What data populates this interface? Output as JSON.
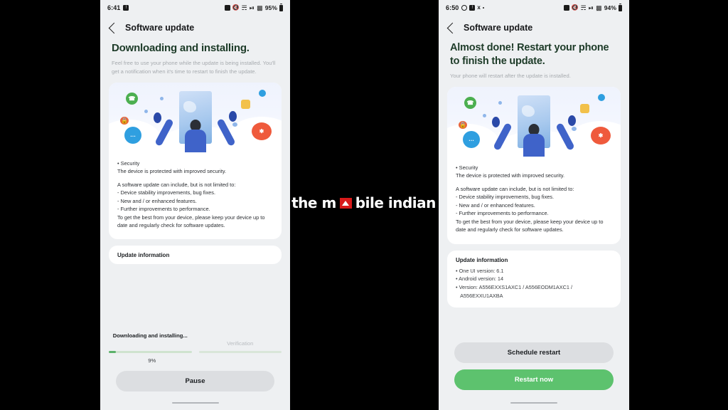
{
  "watermark": {
    "part1": "the m",
    "part2": "bile indian"
  },
  "phones": [
    {
      "id": "left",
      "statusbar": {
        "time": "6:41",
        "left_icons": [
          "notification-square-icon"
        ],
        "right_icons": [
          "alarm-icon",
          "mute-icon",
          "wifi-icon",
          "nfc-icon",
          "signal-icon"
        ],
        "battery": "95%"
      },
      "appbar": {
        "back": "back-icon",
        "title": "Software update"
      },
      "hero": {
        "title": "Downloading and installing.",
        "subtitle": "Feel free to use your phone while the update is being installed. You'll get a notification when it's time to restart to finish the update."
      },
      "notes": {
        "security_bullet": "• Security",
        "security_text": "The device is protected with improved security.",
        "intro": "A software update can include, but is not limited to:",
        "items": [
          " - Device stability improvements, bug fixes.",
          " - New and / or enhanced features.",
          " - Further improvements to performance."
        ],
        "outro": "To get the best from your device, please keep your device up to date and regularly check for software updates."
      },
      "info": {
        "title": "Update information",
        "lines": []
      },
      "progress": {
        "step1_label": "Downloading and installing...",
        "step2_label": "Verification",
        "percent_text": "9%",
        "percent_value": 9
      },
      "buttons": [
        {
          "label": "Pause",
          "style": "grey"
        }
      ]
    },
    {
      "id": "right",
      "statusbar": {
        "time": "6:50",
        "left_icons": [
          "whatsapp-icon",
          "notification-square-icon",
          "x-twitter-icon",
          "more-dot-icon"
        ],
        "right_icons": [
          "alarm-icon",
          "mute-icon",
          "wifi-icon",
          "nfc-icon",
          "signal-icon"
        ],
        "battery": "94%"
      },
      "appbar": {
        "back": "back-icon",
        "title": "Software update"
      },
      "hero": {
        "title": "Almost done! Restart your phone to finish the update.",
        "subtitle": "Your phone will restart after the update is installed."
      },
      "notes": {
        "security_bullet": "• Security",
        "security_text": "The device is protected with improved security.",
        "intro": "A software update can include, but is not limited to:",
        "items": [
          " - Device stability improvements, bug fixes.",
          " - New and / or enhanced features.",
          " - Further improvements to performance."
        ],
        "outro": "To get the best from your device, please keep your device up to date and regularly check for software updates."
      },
      "info": {
        "title": "Update information",
        "lines": [
          "• One UI version: 6.1",
          "• Android version: 14",
          "• Version: A556EXXS1AXC1 / A556EODM1AXC1 /\n   A556EXXU1AXBA"
        ]
      },
      "progress": null,
      "buttons": [
        {
          "label": "Schedule restart",
          "style": "grey"
        },
        {
          "label": "Restart now",
          "style": "green"
        }
      ]
    }
  ],
  "colors": {
    "accent_green": "#5dc26e",
    "progress_green": "#5bb16a",
    "heading_green": "#1d3b28",
    "screen_bg": "#eef0f2",
    "card_bg": "#ffffff",
    "watermark_red": "#d81a1a"
  }
}
